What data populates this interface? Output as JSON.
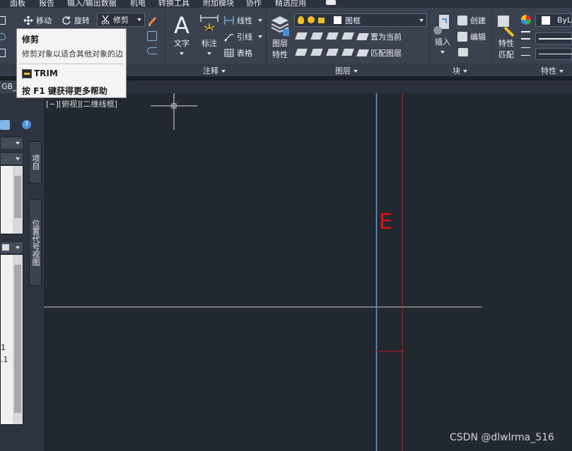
{
  "menubar": {
    "items": [
      "面板",
      "报告",
      "输入/输出数据",
      "机电",
      "转换工具",
      "附加模块",
      "协作",
      "精选应用"
    ]
  },
  "ribbon": {
    "modify": {
      "move": "移动",
      "rotate": "旋转",
      "trim": "修剪"
    },
    "annotation": {
      "text": "文字",
      "dimension": "标注",
      "linear": "线性",
      "leader": "引线",
      "table": "表格",
      "title": "注释"
    },
    "layers": {
      "properties": "图层\n特性",
      "properties_line1": "图层",
      "properties_line2": "特性",
      "current_layer": "图框",
      "make_current": "置为当前",
      "match_layer": "匹配图层",
      "title": "图层"
    },
    "block": {
      "insert": "插入",
      "create": "创建",
      "edit": "编辑",
      "title": "块"
    },
    "properties": {
      "match_line1": "特性",
      "match_line2": "匹配",
      "bylayer": "ByLa",
      "title": "特性"
    }
  },
  "tabs": {
    "file_tab": "GB_a"
  },
  "palette": {
    "tab_items": "项目",
    "tab_location": "位置代号视图",
    "list_values": [
      "1",
      ".1"
    ]
  },
  "canvas": {
    "view_label": "[−][俯视][二维线框]",
    "marker": "E",
    "colors": {
      "blue_line": "#5b9bd5",
      "red_line": "#c0141e",
      "white_line": "#c8c8c8",
      "marker": "#e01010"
    }
  },
  "tooltip": {
    "title": "修剪",
    "description": "修剪对象以适合其他对象的边",
    "command": "TRIM",
    "help": "按 F1 键获得更多帮助"
  },
  "watermark": "CSDN @dlwlrma_516"
}
